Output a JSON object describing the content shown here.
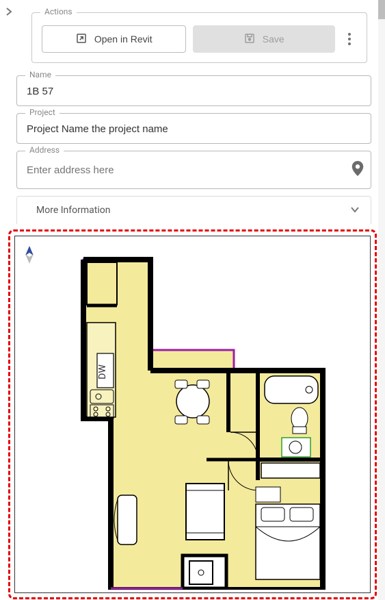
{
  "actions": {
    "legend": "Actions",
    "open_in_revit": "Open in Revit",
    "save": "Save"
  },
  "name": {
    "label": "Name",
    "value": "1B 57"
  },
  "project": {
    "label": "Project",
    "value": "Project Name the project name"
  },
  "address": {
    "label": "Address",
    "placeholder": "Enter address here"
  },
  "more_info": {
    "label": "More Information"
  },
  "floorplan": {
    "appliance_label": "DW",
    "colors": {
      "fill": "#f4ea9c",
      "wall": "#000000",
      "accent": "#9b1fa8"
    }
  }
}
